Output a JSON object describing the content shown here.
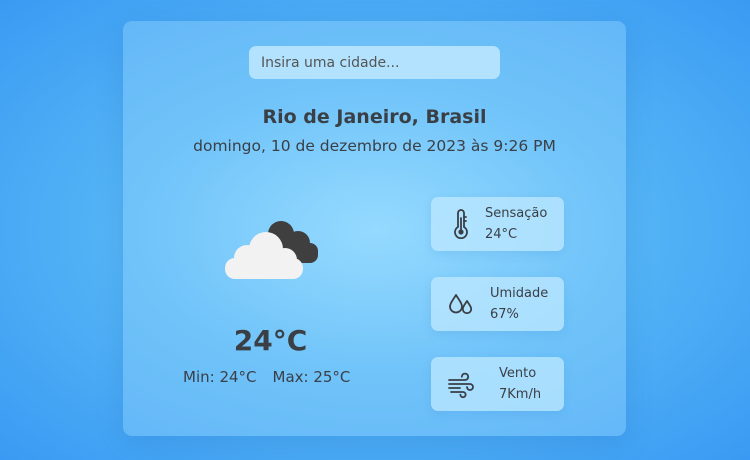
{
  "search": {
    "placeholder": "Insira uma cidade...",
    "value": ""
  },
  "location": {
    "city": "Rio de Janeiro, Brasil",
    "datetime": "domingo, 10 de dezembro de 2023 às 9:26 PM"
  },
  "current": {
    "icon": "cloudy-night-icon",
    "temperature": "24°C",
    "min": "Min: 24°C",
    "max": "Max: 25°C"
  },
  "stats": [
    {
      "icon": "thermometer-icon",
      "label": "Sensação",
      "value": "24°C"
    },
    {
      "icon": "humidity-drops-icon",
      "label": "Umidade",
      "value": "67%"
    },
    {
      "icon": "wind-icon",
      "label": "Vento",
      "value": "7Km/h"
    }
  ],
  "colors": {
    "text": "#3a3f46",
    "cloud_light": "#f2f2f2",
    "cloud_dark": "#3f3f3f",
    "background_center": "#8fd9ff",
    "background_edge": "#3a9af3"
  }
}
